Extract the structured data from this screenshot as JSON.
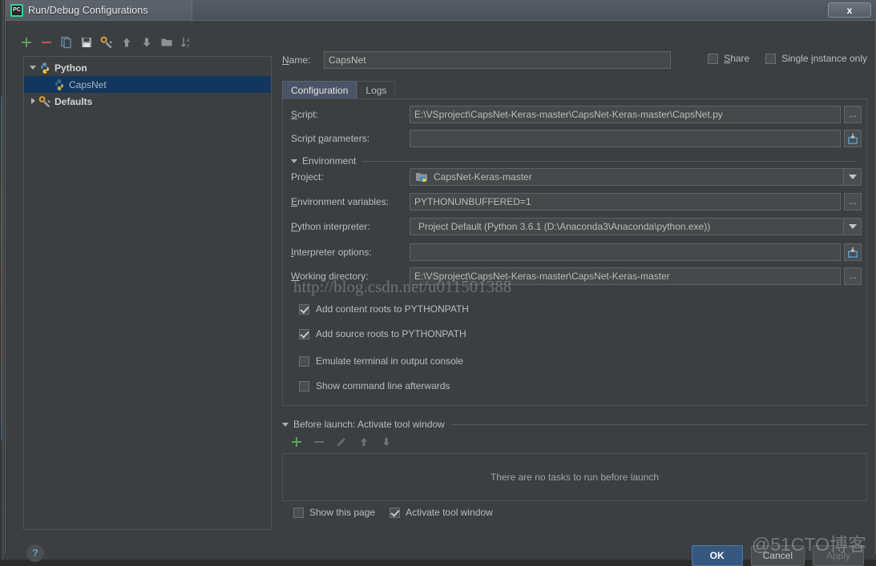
{
  "window": {
    "title": "Run/Debug Configurations",
    "app_icon": "pycharm-icon",
    "close_label": "x"
  },
  "tree_toolbar": {
    "icons": [
      {
        "name": "add-icon",
        "title": "Add New Configuration"
      },
      {
        "name": "remove-icon",
        "title": "Remove Configuration"
      },
      {
        "name": "copy-icon",
        "title": "Copy Configuration"
      },
      {
        "name": "save-icon",
        "title": "Save Configuration"
      },
      {
        "name": "edit-defaults-icon",
        "title": "Edit Defaults"
      },
      {
        "name": "move-up-icon",
        "title": "Move Up"
      },
      {
        "name": "move-down-icon",
        "title": "Move Down"
      },
      {
        "name": "folder-icon",
        "title": "Create New Folder"
      },
      {
        "name": "sort-alphabetically-icon",
        "title": "Sort Configurations"
      }
    ]
  },
  "tree": {
    "nodes": [
      {
        "label": "Python",
        "icon": "python-icon",
        "expanded": true,
        "type": "group",
        "selected": false
      },
      {
        "label": "CapsNet",
        "icon": "python-icon",
        "type": "child",
        "selected": true
      },
      {
        "label": "Defaults",
        "icon": "wrench-icon",
        "expanded": false,
        "type": "group",
        "selected": false
      }
    ]
  },
  "name_field": {
    "label": "Name:",
    "value": "CapsNet",
    "placeholder": ""
  },
  "top_options": [
    {
      "label": "Share",
      "checked": false,
      "name": "share-checkbox"
    },
    {
      "label": "Single instance only",
      "checked": false,
      "name": "single-instance-only-checkbox"
    }
  ],
  "tabs": [
    {
      "label": "Configuration",
      "active": true
    },
    {
      "label": "Logs",
      "active": false
    }
  ],
  "config": {
    "script": {
      "label": "Script:",
      "value": "E:\\VSproject\\CapsNet-Keras-master\\CapsNet-Keras-master\\CapsNet.py",
      "button": "...",
      "button_icon": "browse-icon"
    },
    "script_parameters": {
      "label": "Script parameters:",
      "value": "",
      "placeholder": "",
      "button_icon": "expand-editor-icon"
    },
    "environment_section": {
      "label": "Environment",
      "expanded": true
    },
    "project": {
      "label": "Project:",
      "value": "CapsNet-Keras-master",
      "icon": "project-folder-python-icon",
      "button_icon": "chevron-down-icon"
    },
    "environment_variables": {
      "label": "Environment variables:",
      "value": "PYTHONUNBUFFERED=1",
      "button": "...",
      "button_icon": "browse-icon"
    },
    "python_interpreter": {
      "label": "Python interpreter:",
      "value": "Project Default (Python 3.6.1 (D:\\Anaconda3\\Anaconda\\python.exe))",
      "button_icon": "chevron-down-icon"
    },
    "interpreter_options": {
      "label": "Interpreter options:",
      "value": "",
      "placeholder": "",
      "button_icon": "expand-editor-icon"
    },
    "working_directory": {
      "label": "Working directory:",
      "value": "E:\\VSproject\\CapsNet-Keras-master\\CapsNet-Keras-master",
      "button": "...",
      "button_icon": "browse-icon"
    },
    "checkboxes": [
      {
        "label": "Add content roots to PYTHONPATH",
        "checked": true,
        "name": "add-content-roots-checkbox"
      },
      {
        "label": "Add source roots to PYTHONPATH",
        "checked": true,
        "name": "add-source-roots-checkbox"
      },
      {
        "label": "Emulate terminal in output console",
        "checked": false,
        "name": "emulate-terminal-checkbox"
      },
      {
        "label": "Show command line afterwards",
        "checked": false,
        "name": "show-command-line-checkbox"
      }
    ]
  },
  "before_launch": {
    "title": "Before launch: Activate tool window",
    "expanded": true,
    "toolbar": [
      {
        "name": "add-task-icon",
        "enabled": true
      },
      {
        "name": "remove-task-icon",
        "enabled": false
      },
      {
        "name": "edit-task-icon",
        "enabled": false
      },
      {
        "name": "move-task-up-icon",
        "enabled": false
      },
      {
        "name": "move-task-down-icon",
        "enabled": false
      }
    ],
    "empty_text": "There are no tasks to run before launch",
    "options": [
      {
        "label": "Show this page",
        "checked": false,
        "name": "show-this-page-checkbox"
      },
      {
        "label": "Activate tool window",
        "checked": true,
        "name": "activate-tool-window-checkbox"
      }
    ]
  },
  "footer": {
    "help": "?",
    "buttons": [
      {
        "label": "OK",
        "style": "primary",
        "enabled": true
      },
      {
        "label": "Cancel",
        "style": "default",
        "enabled": true
      },
      {
        "label": "Apply",
        "style": "default",
        "enabled": false
      }
    ]
  },
  "watermarks": {
    "url": "http://blog.csdn.net/u011501388",
    "site": "@51CTO博客"
  },
  "colors": {
    "dialog_bg": "#3c3f41",
    "input_bg": "#45494a",
    "selection": "#13365c",
    "accent": "#365880",
    "tab_active": "#4b5466",
    "add_green": "#5aa25a",
    "remove_red": "#c75450"
  }
}
